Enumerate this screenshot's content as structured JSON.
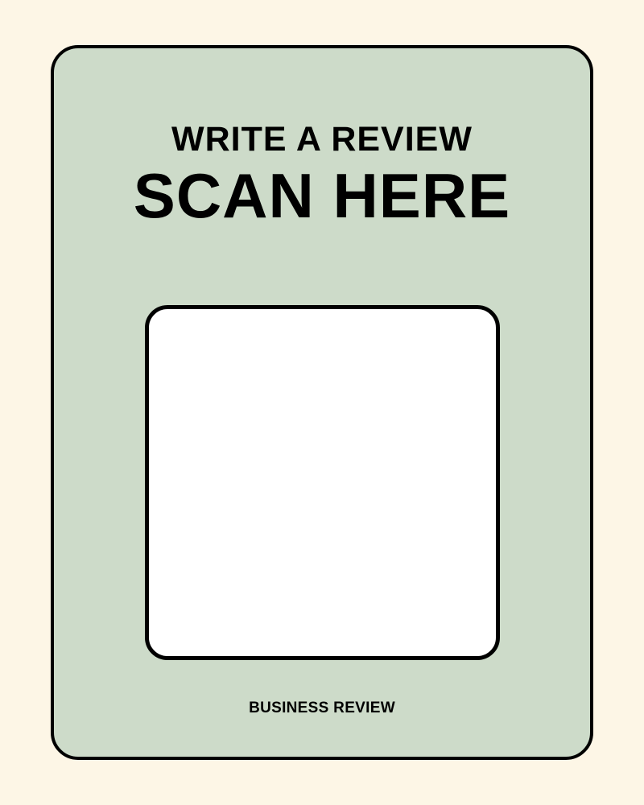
{
  "card": {
    "heading_top": "WRITE A REVIEW",
    "heading_main": "SCAN HERE",
    "footer_label": "BUSINESS REVIEW"
  },
  "colors": {
    "page_background": "#fdf6e6",
    "card_background": "#cddbc9",
    "border": "#000000",
    "qr_area": "#ffffff",
    "text": "#000000"
  }
}
